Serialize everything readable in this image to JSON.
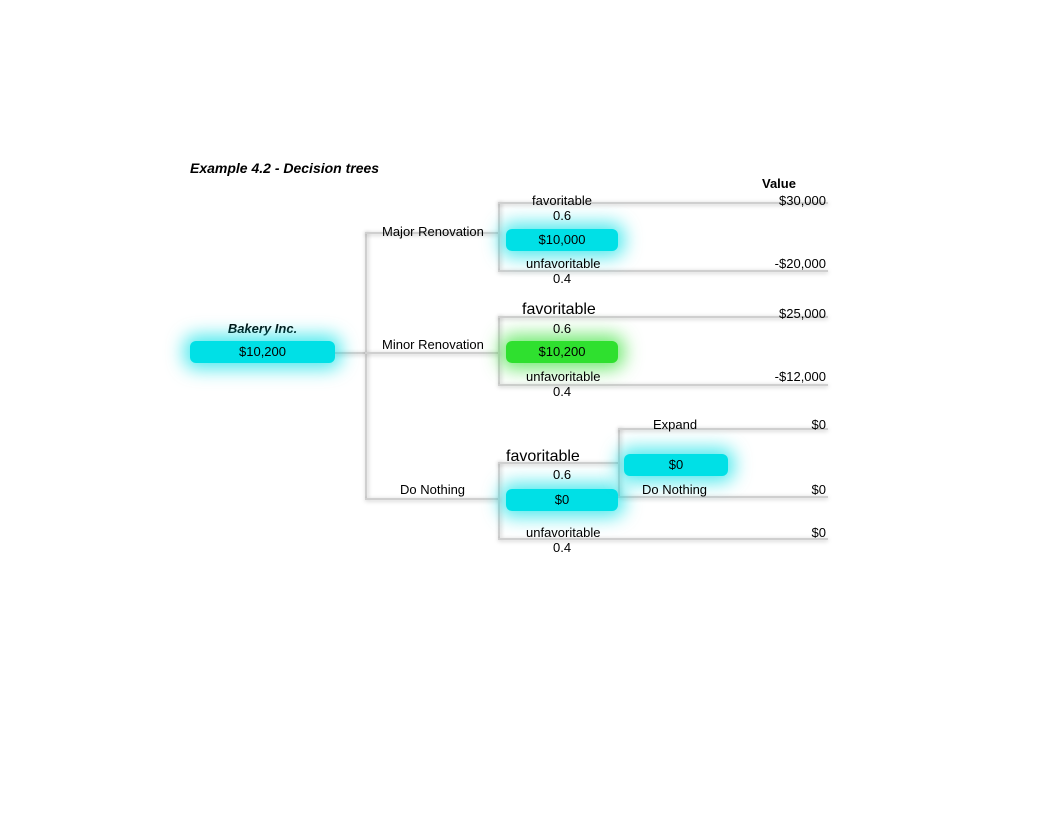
{
  "title": "Example 4.2 - Decision trees",
  "header_value": "Value",
  "root": {
    "name": "Bakery Inc.",
    "value": "$10,200"
  },
  "branches": {
    "major": {
      "label": "Major Renovation",
      "node_value": "$10,000",
      "fav": {
        "label": "favoritable",
        "prob": "0.6",
        "value": "$30,000"
      },
      "unfav": {
        "label": "unfavoritable",
        "prob": "0.4",
        "value": "-$20,000"
      }
    },
    "minor": {
      "label": "Minor Renovation",
      "node_value": "$10,200",
      "fav": {
        "label": "favoritable",
        "prob": "0.6",
        "value": "$25,000"
      },
      "unfav": {
        "label": "unfavoritable",
        "prob": "0.4",
        "value": "-$12,000"
      }
    },
    "nothing": {
      "label": "Do Nothing",
      "node_value": "$0",
      "fav": {
        "label": "favoritable",
        "prob": "0.6"
      },
      "unfav": {
        "label": "unfavoritable",
        "prob": "0.4",
        "value": "$0"
      },
      "sub": {
        "node_value": "$0",
        "expand": {
          "label": "Expand",
          "value": "$0"
        },
        "donothing": {
          "label": "Do Nothing",
          "value": "$0"
        }
      }
    }
  }
}
